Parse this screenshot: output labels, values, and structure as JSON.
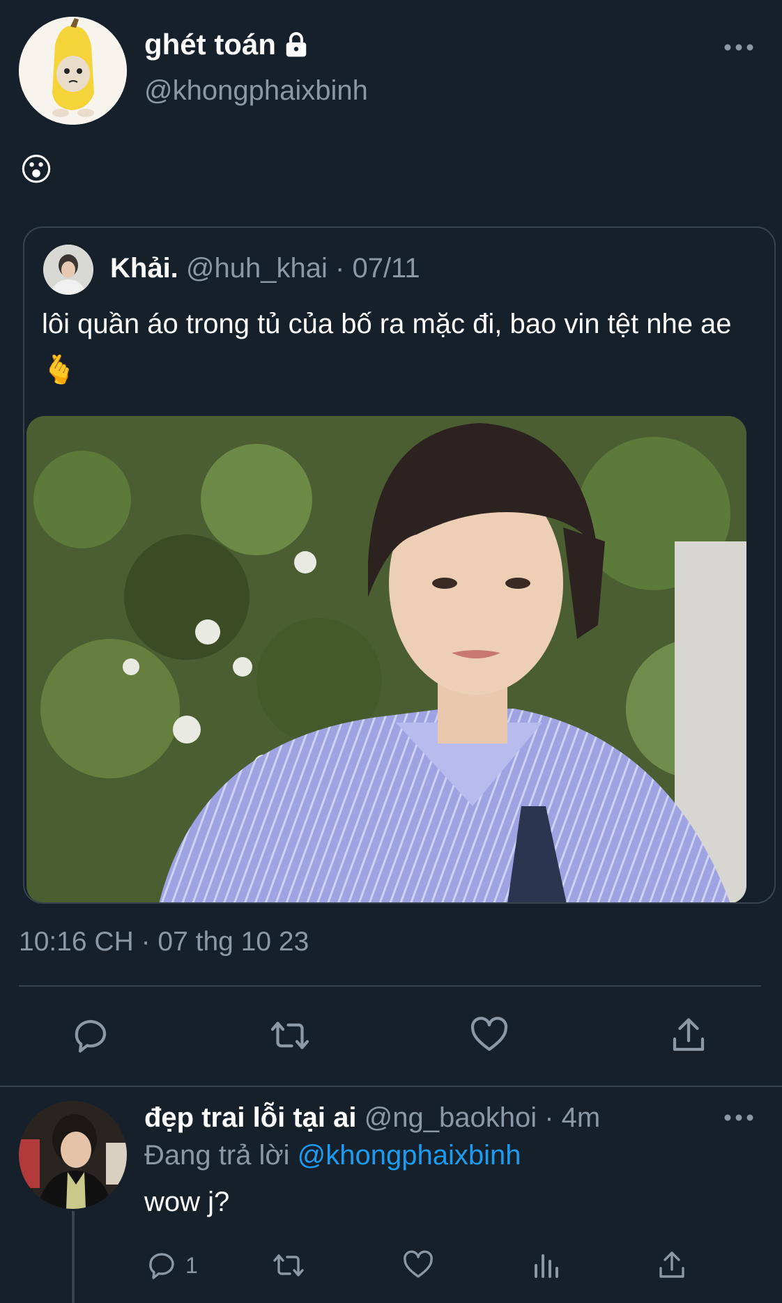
{
  "tweet": {
    "display_name": "ghét toán",
    "handle": "@khongphaixbinh",
    "text": "😮",
    "timestamp": "10:16 CH · 07 thg 10 23",
    "icons": [
      "lock-icon",
      "more-icon"
    ]
  },
  "quote": {
    "name": "Khải.",
    "handle": "@huh_khai",
    "date": "· 07/11",
    "text": "lôi quần áo trong tủ của bố ra mặc đi, bao vin tệt nhe ae🫰"
  },
  "actions": [
    "reply-icon",
    "retweet-icon",
    "like-icon",
    "share-icon"
  ],
  "reply": {
    "name": "đẹp trai lỗi tại ai",
    "handle": "@ng_baokhoi",
    "time": "· 4m",
    "replying_label": "Đang trả lời",
    "replying_to": "@khongphaixbinh",
    "text": "wow j?",
    "reply_count": "1",
    "actions": [
      "reply-icon",
      "retweet-icon",
      "like-icon",
      "views-icon",
      "share-icon"
    ]
  },
  "colors": {
    "background": "#15202b",
    "muted": "#8b98a5",
    "border": "#38444d",
    "link": "#1d9bf0"
  }
}
